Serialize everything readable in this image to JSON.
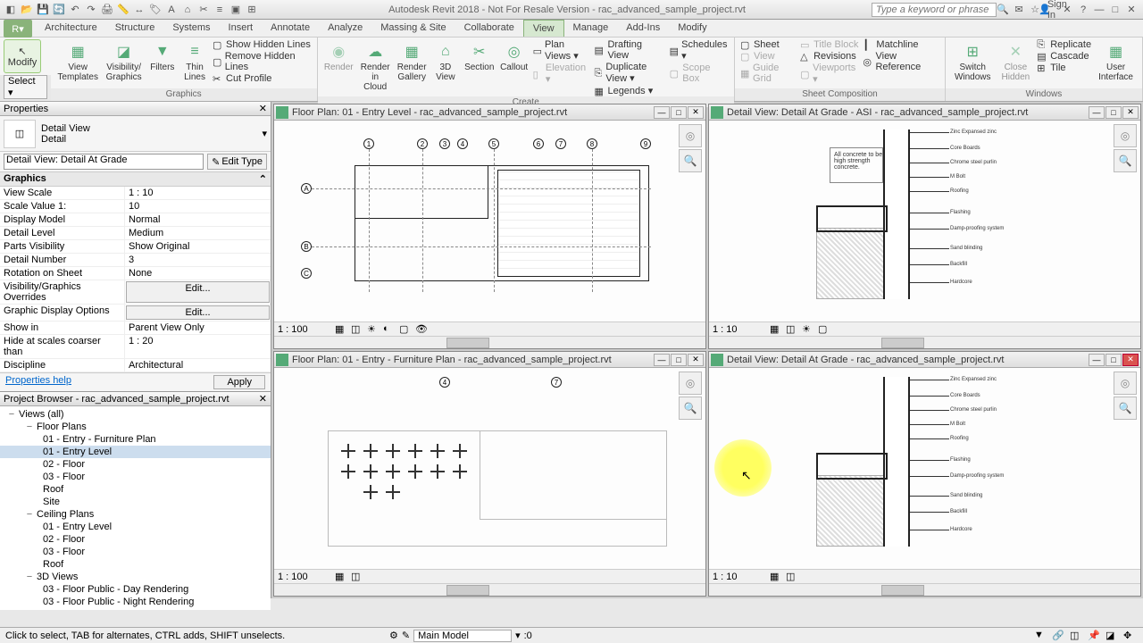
{
  "app": {
    "title": "Autodesk Revit 2018 - Not For Resale Version - rac_advanced_sample_project.rvt",
    "search_placeholder": "Type a keyword or phrase",
    "signin": "Sign In"
  },
  "tabs": [
    "Architecture",
    "Structure",
    "Systems",
    "Insert",
    "Annotate",
    "Analyze",
    "Massing & Site",
    "Collaborate",
    "View",
    "Manage",
    "Add-Ins",
    "Modify"
  ],
  "active_tab": "View",
  "ribbon": {
    "modify": "Modify",
    "select": "Select ▾",
    "groups": {
      "graphics": {
        "label": "Graphics",
        "view_templates": "View\nTemplates",
        "visibility_graphics": "Visibility/\nGraphics",
        "filters": "Filters",
        "thin_lines": "Thin\nLines",
        "show_hidden": "Show Hidden Lines",
        "remove_hidden": "Remove Hidden Lines",
        "cut_profile": "Cut Profile"
      },
      "create": {
        "label": "Create",
        "render": "Render",
        "render_cloud": "Render\nin Cloud",
        "render_gallery": "Render\nGallery",
        "3d_view": "3D\nView",
        "section": "Section",
        "callout": "Callout",
        "plan_views": "Plan Views ▾",
        "elevation": "Elevation ▾",
        "drafting_view": "Drafting View",
        "duplicate_view": "Duplicate View ▾",
        "legends": "Legends ▾",
        "schedules": "Schedules ▾",
        "scope_box": "Scope Box"
      },
      "sheet": {
        "label": "Sheet Composition",
        "sheet": "Sheet",
        "view": "View",
        "title_block": "Title Block",
        "revisions": "Revisions",
        "guide_grid": "Guide Grid",
        "matchline": "Matchline",
        "view_reference": "View Reference",
        "viewports": "Viewports ▾"
      },
      "windows": {
        "label": "Windows",
        "switch": "Switch\nWindows",
        "close": "Close\nHidden",
        "replicate": "Replicate",
        "cascade": "Cascade",
        "tile": "Tile",
        "ui": "User\nInterface"
      }
    }
  },
  "properties": {
    "title": "Properties",
    "type_family": "Detail View",
    "type_name": "Detail",
    "selector": "Detail View: Detail At Grade",
    "edit_type": "Edit Type",
    "category": "Graphics",
    "rows": [
      {
        "k": "View Scale",
        "v": "1 : 10"
      },
      {
        "k": "Scale Value   1:",
        "v": "10"
      },
      {
        "k": "Display Model",
        "v": "Normal"
      },
      {
        "k": "Detail Level",
        "v": "Medium"
      },
      {
        "k": "Parts Visibility",
        "v": "Show Original"
      },
      {
        "k": "Detail Number",
        "v": "3"
      },
      {
        "k": "Rotation on Sheet",
        "v": "None"
      },
      {
        "k": "Visibility/Graphics Overrides",
        "v": "Edit...",
        "btn": true
      },
      {
        "k": "Graphic Display Options",
        "v": "Edit...",
        "btn": true
      },
      {
        "k": "Show in",
        "v": "Parent View Only"
      },
      {
        "k": "Hide at scales coarser than",
        "v": "1 : 20"
      },
      {
        "k": "Discipline",
        "v": "Architectural"
      }
    ],
    "help": "Properties help",
    "apply": "Apply"
  },
  "browser": {
    "title": "Project Browser - rac_advanced_sample_project.rvt",
    "nodes": [
      {
        "l": 1,
        "exp": "−",
        "t": "Views (all)"
      },
      {
        "l": 2,
        "exp": "−",
        "t": "Floor Plans"
      },
      {
        "l": 3,
        "t": "01 - Entry - Furniture Plan"
      },
      {
        "l": 3,
        "t": "01 - Entry Level",
        "sel": true
      },
      {
        "l": 3,
        "t": "02 - Floor"
      },
      {
        "l": 3,
        "t": "03 - Floor"
      },
      {
        "l": 3,
        "t": "Roof"
      },
      {
        "l": 3,
        "t": "Site"
      },
      {
        "l": 2,
        "exp": "−",
        "t": "Ceiling Plans"
      },
      {
        "l": 3,
        "t": "01 - Entry Level"
      },
      {
        "l": 3,
        "t": "02 - Floor"
      },
      {
        "l": 3,
        "t": "03 - Floor"
      },
      {
        "l": 3,
        "t": "Roof"
      },
      {
        "l": 2,
        "exp": "−",
        "t": "3D Views"
      },
      {
        "l": 3,
        "t": "03 - Floor Public - Day Rendering"
      },
      {
        "l": 3,
        "t": "03 - Floor Public - Night Rendering"
      }
    ]
  },
  "viewports": {
    "tl": {
      "title": "Floor Plan: 01 - Entry Level - rac_advanced_sample_project.rvt",
      "scale": "1 : 100"
    },
    "tr": {
      "title": "Detail View: Detail At Grade - ASI - rac_advanced_sample_project.rvt",
      "scale": "1 : 10"
    },
    "bl": {
      "title": "Floor Plan: 01 - Entry - Furniture Plan - rac_advanced_sample_project.rvt",
      "scale": "1 : 100"
    },
    "br": {
      "title": "Detail View: Detail At Grade - rac_advanced_sample_project.rvt",
      "scale": "1 : 10",
      "active": true
    }
  },
  "status": {
    "msg": "Click to select, TAB for alternates, CTRL adds, SHIFT unselects.",
    "workset": "Main Model",
    "zero": ":0"
  }
}
